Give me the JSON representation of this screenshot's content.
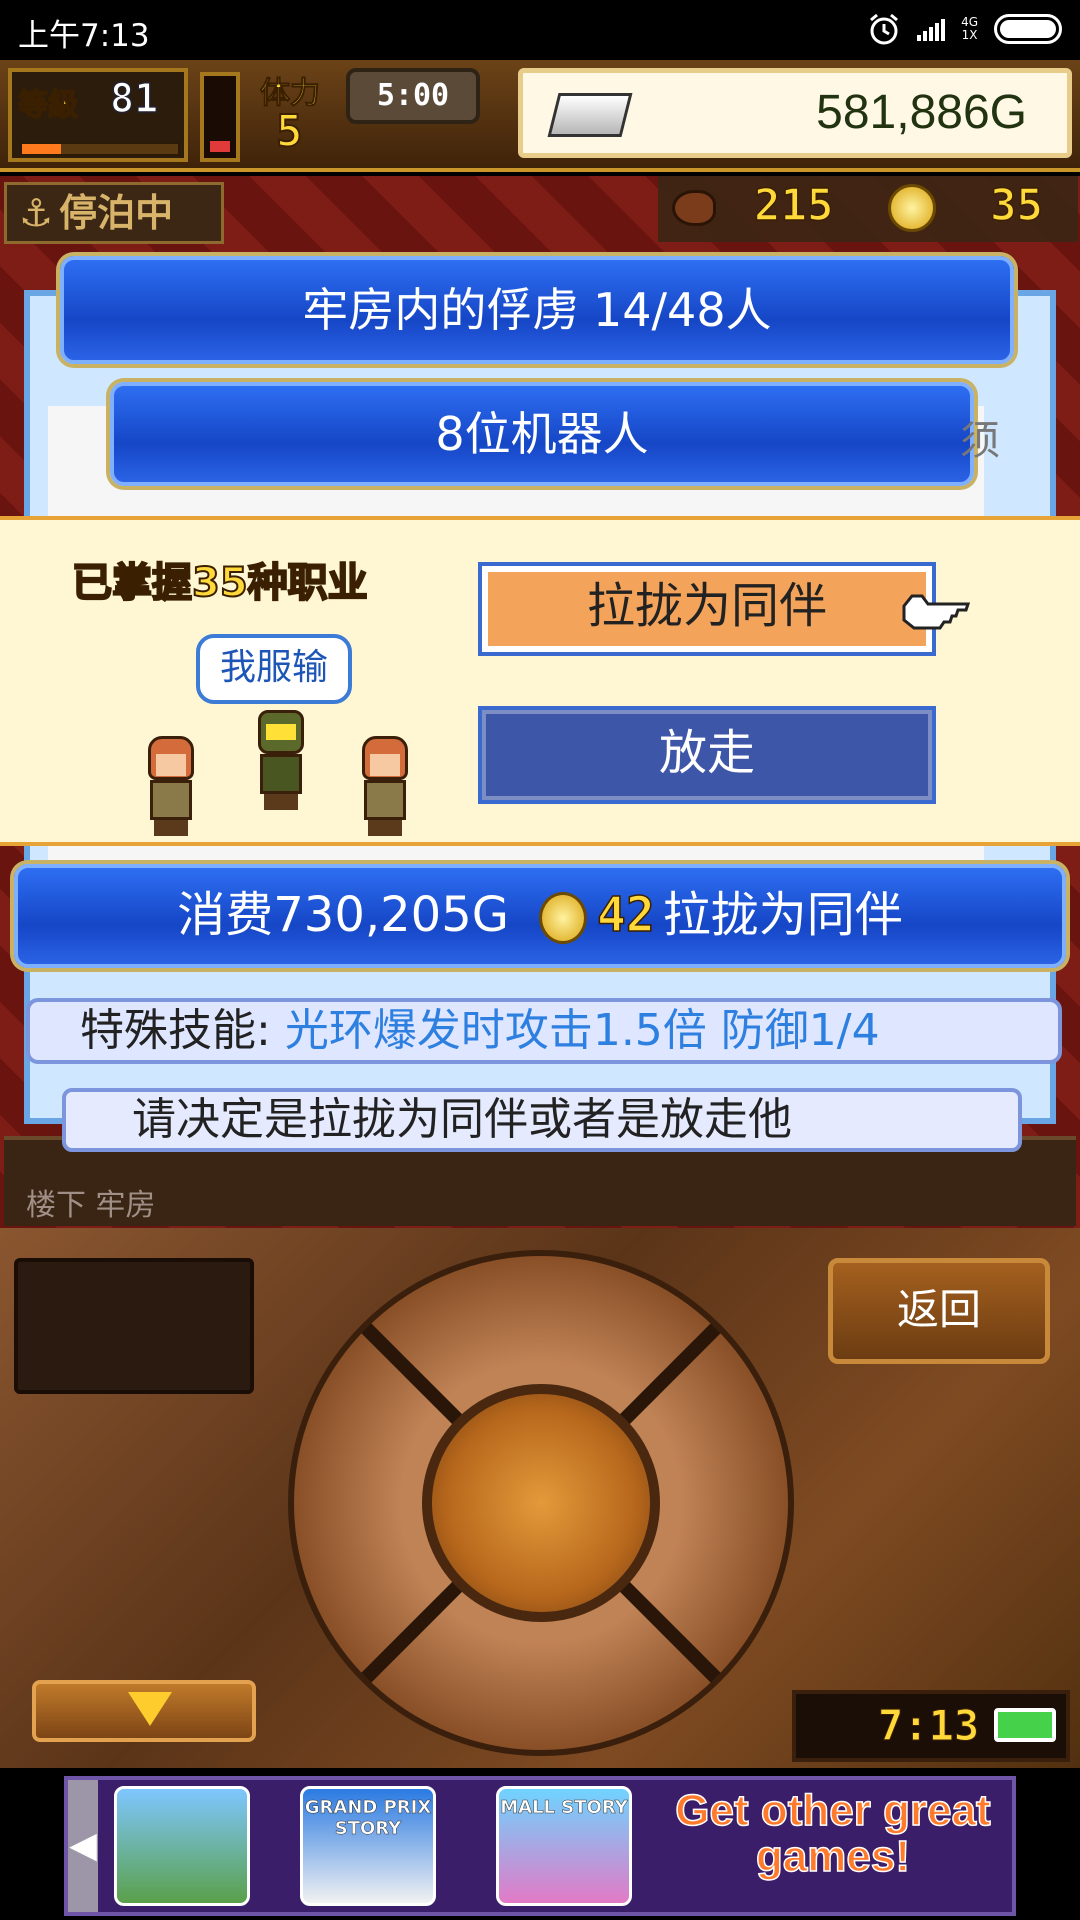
{
  "status_bar": {
    "time": "上午7:13",
    "network_top": "4G",
    "network_bottom": "1X"
  },
  "hud": {
    "level_label": "等級",
    "level_value": "81",
    "stamina_label": "体力",
    "stamina_value": "5",
    "timer": "5:00",
    "gold": "581,886G"
  },
  "scene": {
    "docked_label": "停泊中",
    "food_count": "215",
    "medal_count": "35",
    "prisoners_title": "牢房内的俘虏  14/48人",
    "group_title": "8位机器人",
    "clipped_right_text": "须"
  },
  "dialog": {
    "mastered_prefix": "已掌握",
    "mastered_count": "35",
    "mastered_suffix": "种职业",
    "speech": "我服输",
    "recruit_label": "拉拢为同伴",
    "release_label": "放走"
  },
  "cost": {
    "prefix": "消费730,205G",
    "medals": "42",
    "action": "拉拢为同伴"
  },
  "skill": {
    "label": "特殊技能:",
    "value": "光环爆发时攻击1.5倍 防御1/4"
  },
  "hint": "请决定是拉拢为同伴或者是放走他",
  "location": "楼下 牢房",
  "controls": {
    "back_label": "返回",
    "clock": "7:13"
  },
  "ad": {
    "thumb2_text": "GRAND PRIX STORY",
    "thumb3_text": "MALL STORY",
    "promo": "Get other great games!"
  },
  "colors": {
    "primary_blue": "#1546c6",
    "recruit_orange": "#f3a45a",
    "release_navy": "#3d56a8",
    "skill_blue": "#2d7fe0"
  }
}
